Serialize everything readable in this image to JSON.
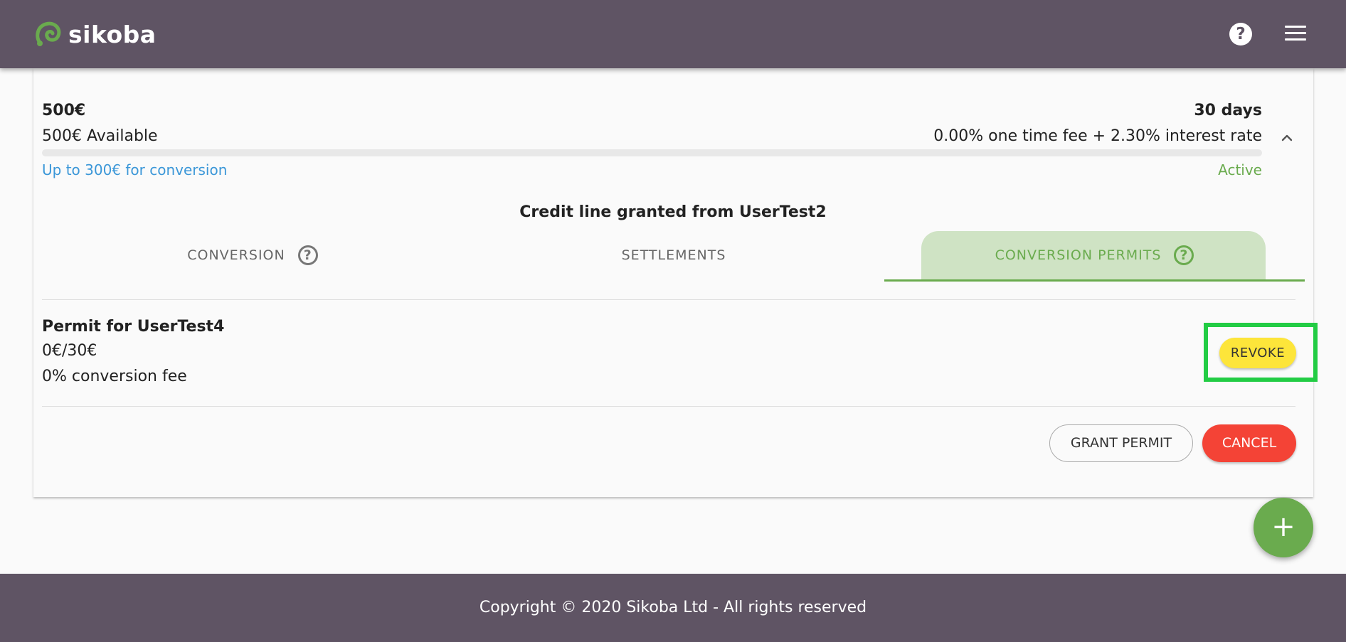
{
  "header": {
    "logo_text": "sikoba",
    "help_icon": "help-circle-icon",
    "menu_icon": "hamburger-menu-icon"
  },
  "credit_line": {
    "amount": "500€",
    "duration": "30 days",
    "available": "500€ Available",
    "rates": "0.00% one time fee + 2.30% interest rate",
    "conversion_limit": "Up to 300€ for conversion",
    "status": "Active",
    "used_fraction": 0,
    "granted_from": "Credit line granted from UserTest2"
  },
  "tabs": [
    {
      "label": "CONVERSION",
      "has_help": true,
      "active": false
    },
    {
      "label": "SETTLEMENTS",
      "has_help": false,
      "active": false
    },
    {
      "label": "CONVERSION PERMITS",
      "has_help": true,
      "active": true
    }
  ],
  "permit": {
    "title": "Permit for UserTest4",
    "used": "0€/30€",
    "fee": "0% conversion fee",
    "revoke_label": "REVOKE"
  },
  "actions": {
    "grant_label": "GRANT PERMIT",
    "cancel_label": "CANCEL"
  },
  "fab": {
    "label": "+"
  },
  "footer": {
    "copyright": "Copyright © 2020 Sikoba Ltd - All rights reserved"
  },
  "colors": {
    "brand": "#5f5464",
    "accent_green": "#6aab4e",
    "link_blue": "#3b97d8",
    "revoke_yellow": "#fde53a",
    "cancel_red": "#f44336",
    "highlight_green": "#22cc44"
  }
}
